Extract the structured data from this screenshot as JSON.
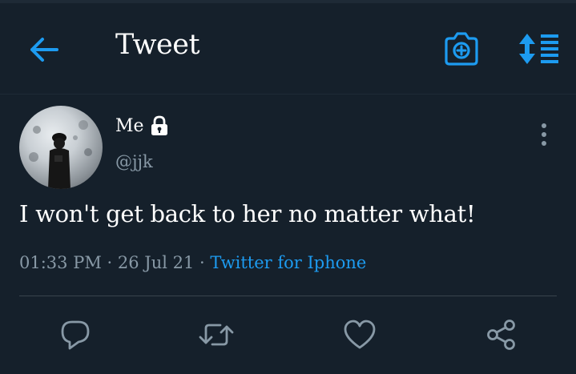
{
  "header": {
    "title": "Tweet",
    "back_icon": "back-arrow-icon",
    "camera_icon": "camera-plus-icon",
    "sort_icon": "sort-list-icon"
  },
  "tweet": {
    "author_name": "Me",
    "lock_icon": "lock-icon",
    "handle": "@jjk",
    "text": "I won't get back to her no matter what!",
    "time": "01:33 PM",
    "date": "26 Jul 21",
    "source": "Twitter for Iphone"
  },
  "actions": [
    "reply-icon",
    "retweet-icon",
    "like-icon",
    "share-icon"
  ],
  "colors": {
    "background": "#15202b",
    "accent": "#1d9bf0",
    "secondary_text": "#8899a6",
    "primary_text": "#ffffff"
  }
}
